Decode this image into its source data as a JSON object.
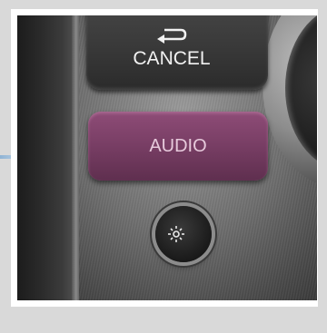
{
  "photo": {
    "description_icons": [
      "undo-arrow-icon",
      "sun-icon",
      "moon-icon"
    ],
    "buttons": {
      "cancel": {
        "label": "CANCEL"
      },
      "audio": {
        "label": "AUDIO",
        "color": "#7a3f66"
      },
      "brightness": {
        "icons": [
          "sun-icon",
          "moon-icon"
        ]
      }
    }
  },
  "colors": {
    "frame": "#ffffff",
    "background": "#d9d9d9",
    "connector": "#8fb3d4"
  }
}
